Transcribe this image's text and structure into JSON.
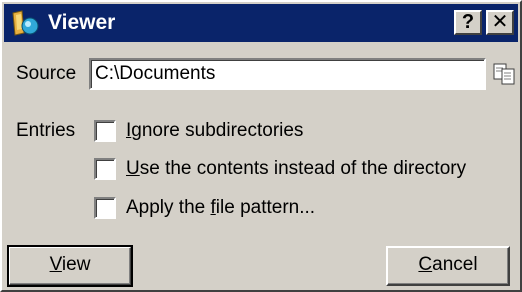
{
  "window": {
    "title": "Viewer",
    "help_button": "?",
    "close_button": "✕"
  },
  "form": {
    "source_label": "Source",
    "source_value": "C:\\Documents",
    "entries_label": "Entries",
    "options": [
      {
        "label_pre": "",
        "label_key": "I",
        "label_post": "gnore subdirectories",
        "checked": false
      },
      {
        "label_pre": "",
        "label_key": "U",
        "label_post": "se the contents instead of the directory",
        "checked": false
      },
      {
        "label_pre": "Apply the ",
        "label_key": "f",
        "label_post": "ile pattern...",
        "checked": false
      }
    ]
  },
  "buttons": {
    "view_key": "V",
    "view_rest": "iew",
    "cancel_key": "C",
    "cancel_rest": "ancel"
  },
  "colors": {
    "titlebar": "#0a246a",
    "face": "#d4d0c8"
  },
  "icons": {
    "title": "viewer-app-icon",
    "browse": "copy-pages-icon"
  }
}
